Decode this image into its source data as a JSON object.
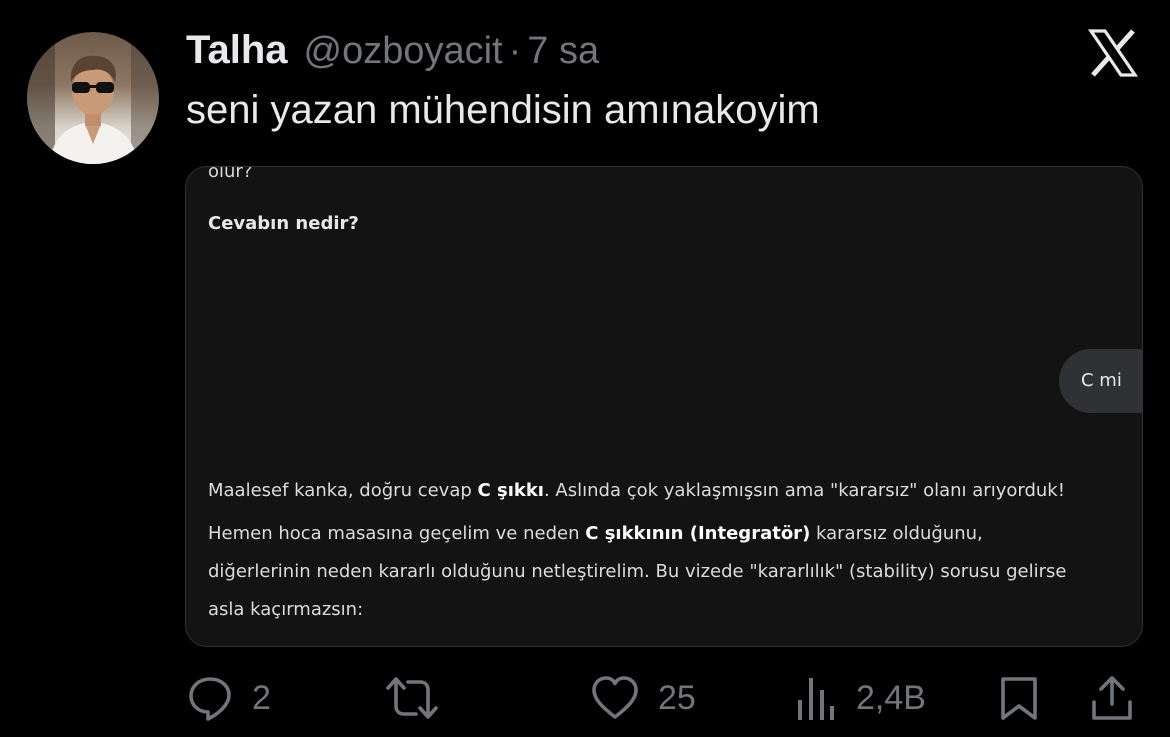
{
  "author": {
    "name": "Talha",
    "handle": "@ozboyacit",
    "separator": "·",
    "time": "7 sa"
  },
  "tweet": {
    "text": "seni yazan mühendisin amınakoyim"
  },
  "media": {
    "cut_text": "olur?",
    "question": "Cevabın nedir?",
    "user_reply": "C mi",
    "answer": {
      "p1_a": "Maalesef kanka, doğru cevap ",
      "p1_b": "C şıkkı",
      "p1_c": ". Aslında çok yaklaşmışsın ama \"kararsız\" olanı arıyorduk!",
      "p2_a": "Hemen hoca masasına geçelim ve neden ",
      "p2_b": "C şıkkının (Integratör)",
      "p2_c": " kararsız olduğunu,",
      "p2_d": "diğerlerinin neden kararlı olduğunu netleştirelim. Bu vizede \"kararlılık\" (stability) sorusu gelirse",
      "p2_e": "asla kaçırmazsın:"
    }
  },
  "actions": {
    "replies": "2",
    "reposts": "",
    "likes": "25",
    "views": "2,4B"
  },
  "icons": {
    "reply": "reply-icon",
    "repost": "repost-icon",
    "like": "heart-icon",
    "views": "views-icon",
    "bookmark": "bookmark-icon",
    "share": "share-icon",
    "logo": "x-logo-icon"
  },
  "colors": {
    "background": "#000000",
    "text": "#e7e9ea",
    "muted": "#71767b",
    "card": "#131314",
    "bubble": "#303134"
  }
}
